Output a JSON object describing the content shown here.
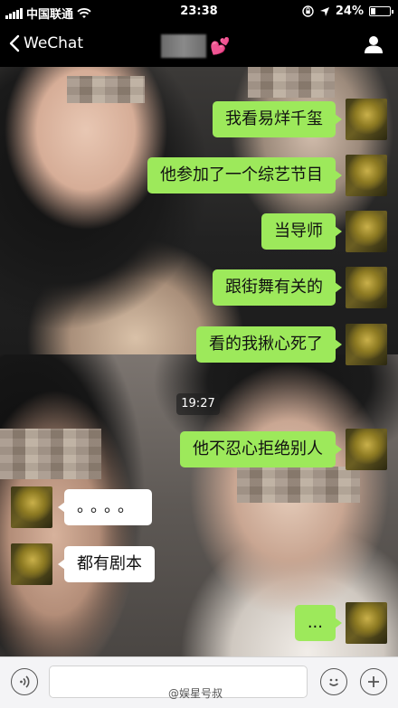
{
  "status_bar": {
    "carrier": "中国联通",
    "time": "23:38",
    "battery": "24%"
  },
  "nav": {
    "back_label": "WeChat",
    "title_emoji": "💕"
  },
  "messages": [
    {
      "side": "right",
      "text": "我看易烊千玺"
    },
    {
      "side": "right",
      "text": "他参加了一个综艺节目"
    },
    {
      "side": "right",
      "text": "当导师"
    },
    {
      "side": "right",
      "text": "跟街舞有关的"
    },
    {
      "side": "right",
      "text": "看的我揪心死了"
    },
    {
      "side": "right",
      "text": "他不忍心拒绝别人"
    },
    {
      "side": "left",
      "text": "。。。。"
    },
    {
      "side": "left",
      "text": "都有剧本"
    },
    {
      "side": "right",
      "text": "..."
    }
  ],
  "timestamp": "19:27",
  "input_bar": {
    "placeholder": ""
  },
  "watermark": "@娱星号叔"
}
